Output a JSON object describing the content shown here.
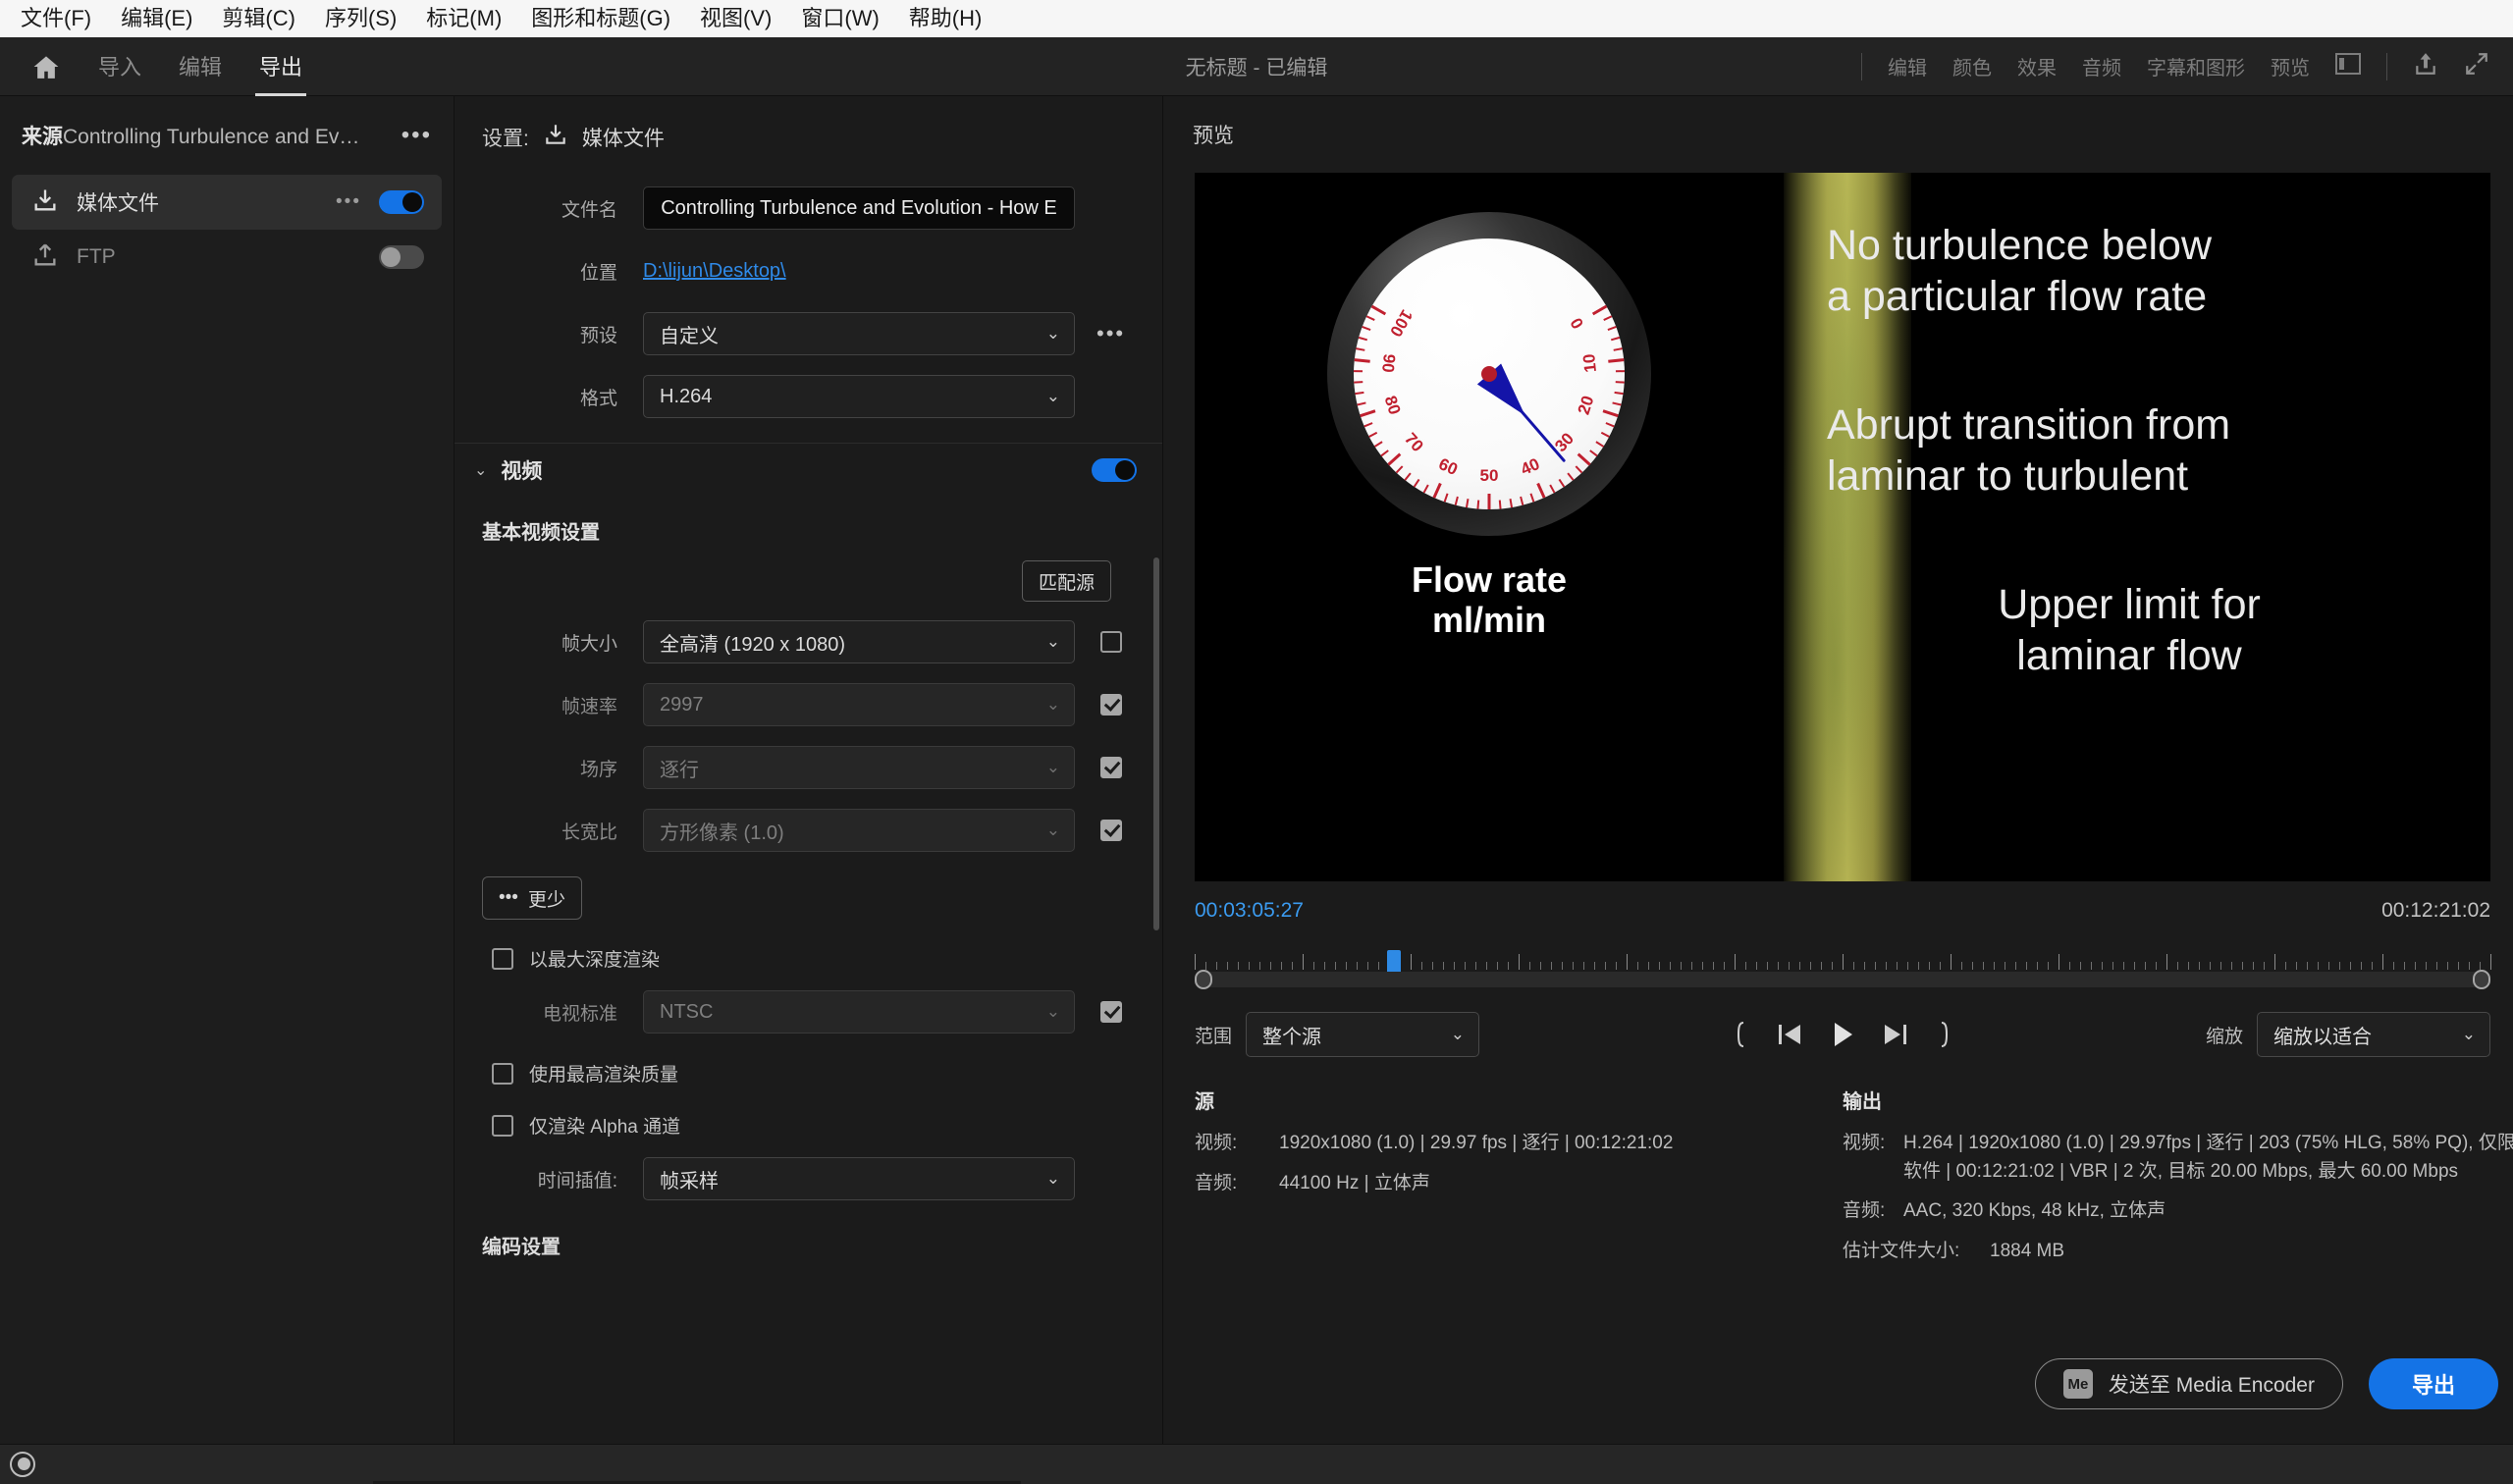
{
  "menubar": [
    {
      "label": "文件(F)"
    },
    {
      "label": "编辑(E)"
    },
    {
      "label": "剪辑(C)"
    },
    {
      "label": "序列(S)"
    },
    {
      "label": "标记(M)"
    },
    {
      "label": "图形和标题(G)"
    },
    {
      "label": "视图(V)"
    },
    {
      "label": "窗口(W)"
    },
    {
      "label": "帮助(H)"
    }
  ],
  "topbar": {
    "tabs": [
      {
        "label": "导入",
        "active": false
      },
      {
        "label": "编辑",
        "active": false
      },
      {
        "label": "导出",
        "active": true
      }
    ],
    "window_title": "无标题 - 已编辑",
    "workspaces": [
      "编辑",
      "颜色",
      "效果",
      "音频",
      "字幕和图形",
      "预览"
    ]
  },
  "sidebar": {
    "source_prefix": "来源",
    "source_name": "Controlling Turbulence and Evoluti...",
    "items": [
      {
        "label": "媒体文件",
        "icon": "download-icon",
        "toggle": "on",
        "selected": true
      },
      {
        "label": "FTP",
        "icon": "upload-icon",
        "toggle": "off",
        "selected": false
      }
    ]
  },
  "settings": {
    "title_prefix": "设置:",
    "title_value": "媒体文件",
    "filename_label": "文件名",
    "filename_value": "Controlling Turbulence and Evolution - How E",
    "location_label": "位置",
    "location_value": "D:\\lijun\\Desktop\\",
    "preset_label": "预设",
    "preset_value": "自定义",
    "format_label": "格式",
    "format_value": "H.264",
    "video_section": "视频",
    "video_toggle": "on",
    "basic_video_heading": "基本视频设置",
    "match_source": "匹配源",
    "frame_size_label": "帧大小",
    "frame_size_value": "全高清 (1920 x 1080)",
    "frame_size_checked": false,
    "frame_rate_label": "帧速率",
    "frame_rate_value": "2997",
    "frame_rate_checked": true,
    "field_order_label": "场序",
    "field_order_value": "逐行",
    "field_order_checked": true,
    "aspect_label": "长宽比",
    "aspect_value": "方形像素 (1.0)",
    "aspect_checked": true,
    "less_button": "更少",
    "render_max_depth": "以最大深度渲染",
    "render_max_depth_checked": false,
    "tv_standard_label": "电视标准",
    "tv_standard_value": "NTSC",
    "tv_standard_checked": true,
    "max_render_quality": "使用最高渲染质量",
    "max_render_quality_checked": false,
    "alpha_only": "仅渲染 Alpha 通道",
    "alpha_only_checked": false,
    "time_interp_label": "时间插值:",
    "time_interp_value": "帧采样",
    "encoding_heading": "编码设置"
  },
  "preview": {
    "title": "预览",
    "video": {
      "gauge": {
        "unit_label_line1": "Flow rate",
        "unit_label_line2": "ml/min",
        "ticks": [
          "0",
          "10",
          "20",
          "30",
          "40",
          "50",
          "60",
          "70",
          "80",
          "90",
          "100"
        ],
        "needle_value": 33,
        "min": 0,
        "max": 100
      },
      "captions": [
        "No turbulence below\na particular flow rate",
        "Abrupt transition from\nlaminar to turbulent",
        "Upper limit for\nlaminar flow"
      ]
    },
    "timecode_in": "00:03:05:27",
    "timecode_out": "00:12:21:02",
    "range_label": "范围",
    "range_value": "整个源",
    "zoom_label": "缩放",
    "zoom_value": "缩放以适合",
    "transport_buttons": [
      "in-point-icon",
      "step-back-icon",
      "play-icon",
      "step-forward-icon",
      "out-point-icon"
    ]
  },
  "info": {
    "source_heading": "源",
    "source_video_key": "视频:",
    "source_video_value": "1920x1080 (1.0) | 29.97 fps | 逐行 | 00:12:21:02",
    "source_audio_key": "音频:",
    "source_audio_value": "44100 Hz | 立体声",
    "output_heading": "输出",
    "output_video_key": "视频:",
    "output_video_value": "H.264 | 1920x1080 (1.0) | 29.97fps | 逐行 | 203 (75% HLG, 58% PQ), 仅限软件 | 00:12:21:02 | VBR | 2 次, 目标 20.00 Mbps, 最大 60.00 Mbps",
    "output_audio_key": "音频:",
    "output_audio_value": "AAC, 320 Kbps, 48 kHz, 立体声",
    "est_size_key": "估计文件大小:",
    "est_size_value": "1884 MB"
  },
  "footer": {
    "media_encoder_button": "发送至 Media Encoder",
    "media_encoder_badge": "Me",
    "export_button": "导出"
  },
  "colors": {
    "accent": "#1473e6",
    "link": "#2f8ae8",
    "gauge_red": "#c0202f",
    "gauge_needle": "#1414a8"
  }
}
